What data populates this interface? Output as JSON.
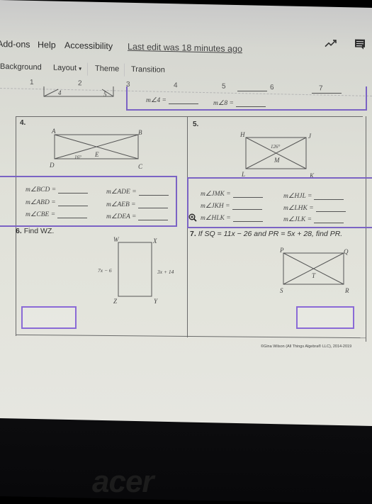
{
  "menubar": {
    "items": [
      "Add-ons",
      "Help",
      "Accessibility"
    ],
    "last_edit": "Last edit was 18 minutes ago"
  },
  "toolbar": {
    "items": [
      "Background",
      "Layout",
      "Theme",
      "Transition"
    ],
    "layout_dropdown_icon": "caret-down-icon"
  },
  "header_icons": [
    "trend-icon",
    "comment-icon"
  ],
  "ruler": {
    "ticks": [
      "1",
      "2",
      "3",
      "4",
      "5",
      "6",
      "7"
    ]
  },
  "problem3": {
    "labels": [
      "4",
      "5"
    ],
    "eq1": "m∠4 =",
    "eq2": "m∠8 ="
  },
  "problem4": {
    "number": "4.",
    "vertices": {
      "A": "A",
      "B": "B",
      "C": "C",
      "D": "D",
      "E": "E"
    },
    "angle": "16°",
    "equations": [
      "m∠BCD =",
      "m∠ABD =",
      "m∠CBE =",
      "m∠ADE =",
      "m∠AEB =",
      "m∠DEA ="
    ]
  },
  "problem5": {
    "number": "5.",
    "vertices": {
      "H": "H",
      "J": "J",
      "K": "K",
      "L": "L",
      "M": "M"
    },
    "angle": "126°",
    "equations": [
      "m∠JMK =",
      "m∠JKH =",
      "m∠HLK =",
      "m∠HJL =",
      "m∠LHK =",
      "m∠JLK ="
    ]
  },
  "problem6": {
    "number": "6.",
    "prompt": "Find WZ.",
    "vertices": {
      "W": "W",
      "X": "X",
      "Y": "Y",
      "Z": "Z"
    },
    "left_side": "7x − 6",
    "right_side": "3x + 14"
  },
  "problem7": {
    "number": "7.",
    "prompt": "If SQ = 11x − 26 and PR = 5x + 28, find PR.",
    "vertices": {
      "P": "P",
      "Q": "Q",
      "R": "R",
      "S": "S",
      "T": "T"
    }
  },
  "copyright": "©Gina Wilson (All Things Algebra® LLC), 2014-2019",
  "bezel_logo": "acer"
}
